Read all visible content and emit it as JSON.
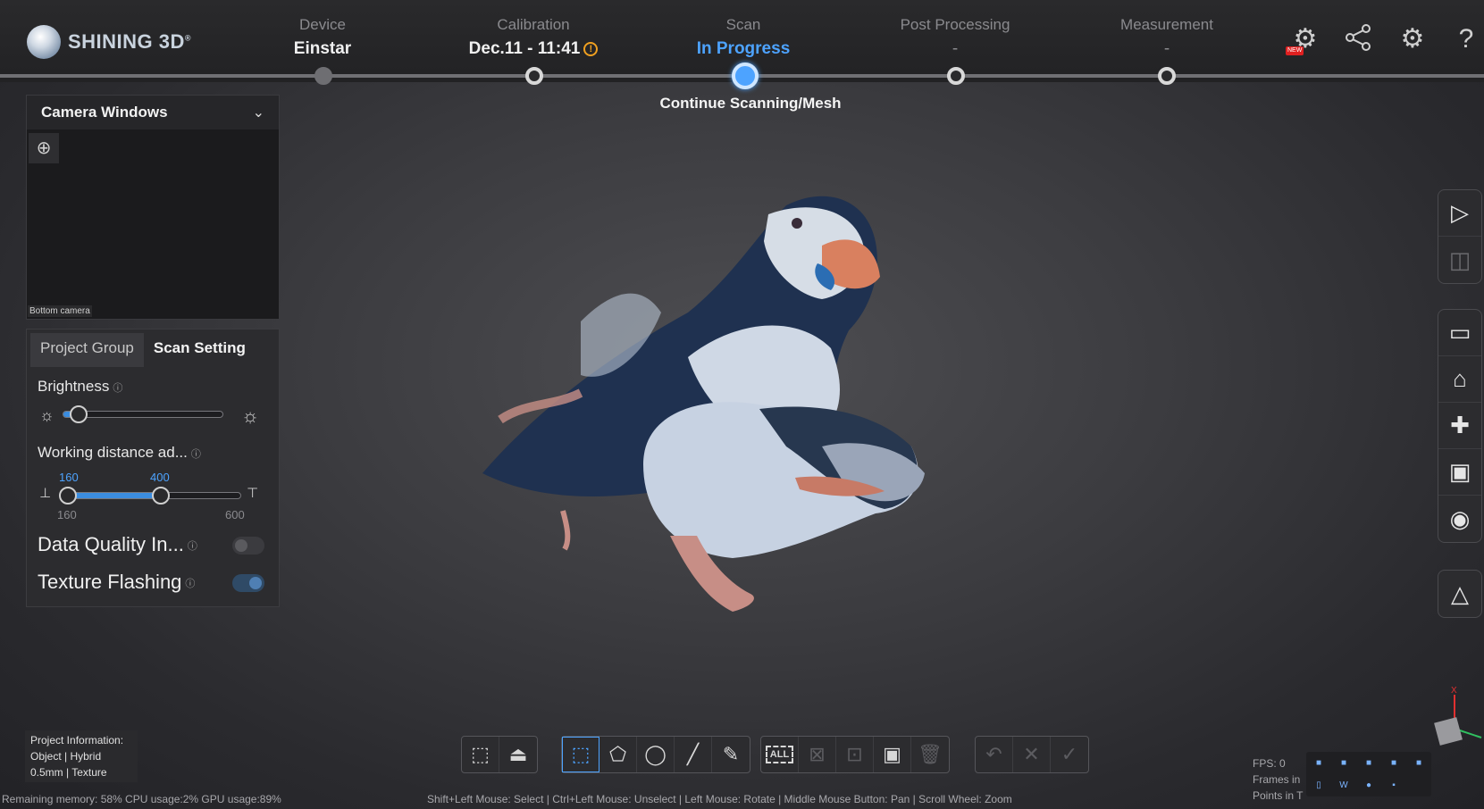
{
  "brand": {
    "name": "SHINING 3D",
    "reg": "®"
  },
  "workflow": [
    {
      "label": "Device",
      "value": "Einstar",
      "state": "done"
    },
    {
      "label": "Calibration",
      "value": "Dec.11 - 11:41",
      "state": "warn"
    },
    {
      "label": "Scan",
      "value": "In Progress",
      "state": "active"
    },
    {
      "label": "Post Processing",
      "value": "-",
      "state": "pending"
    },
    {
      "label": "Measurement",
      "value": "-",
      "state": "pending"
    }
  ],
  "scan_hint": "Continue Scanning/Mesh",
  "top_icons": [
    "new-feature-icon",
    "share-icon",
    "settings-icon",
    "help-icon"
  ],
  "top_icon_badge": "NEW",
  "camera_panel": {
    "title": "Camera Windows",
    "camera_label": "Bottom camera"
  },
  "settings_panel": {
    "tabs": [
      "Project Group",
      "Scan Setting"
    ],
    "active_tab": "Scan Setting",
    "brightness": {
      "label": "Brightness",
      "level": 0.1
    },
    "working_distance": {
      "label": "Working distance ad...",
      "low_value": "160",
      "high_value": "400",
      "min_label": "160",
      "max_label": "600"
    },
    "data_quality": {
      "label": "Data Quality In...",
      "enabled": false
    },
    "texture_flashing": {
      "label": "Texture Flashing",
      "enabled": true
    }
  },
  "right_toolbar": [
    [
      "start-scan-icon",
      "frame-select-icon"
    ],
    [
      "panel-icon",
      "clean-icon",
      "plugin-icon",
      "save-icon",
      "visibility-icon"
    ],
    [
      "mesh-icon"
    ]
  ],
  "bottom_toolbar": {
    "view": [
      "view-cube-icon",
      "base-plane-icon"
    ],
    "select": [
      "rect-select-icon",
      "polygon-select-icon",
      "lasso-select-icon",
      "line-select-icon",
      "brush-select-icon"
    ],
    "edit": [
      "select-all-icon",
      "deselect-icon",
      "invert-select-icon",
      "connected-select-icon",
      "delete-icon"
    ],
    "confirm": [
      "undo-icon",
      "cancel-icon",
      "apply-icon"
    ],
    "all_label": "ALL"
  },
  "project_info": {
    "heading": "Project Information:",
    "line1": "Object | Hybrid",
    "line2": "0.5mm | Texture"
  },
  "status": {
    "resources": "Remaining memory: 58% CPU usage:2%  GPU usage:89%",
    "hint": "Shift+Left Mouse: Select | Ctrl+Left Mouse: Unselect | Left Mouse: Rotate | Middle Mouse Button: Pan | Scroll Wheel: Zoom"
  },
  "stats": {
    "fps": "FPS: 0",
    "frames": "Frames in",
    "points": "Points in T"
  },
  "axis_label": "X",
  "colors": {
    "accent": "#4da3ff",
    "warning": "#f0a020",
    "panel": "#2c2c2f"
  }
}
